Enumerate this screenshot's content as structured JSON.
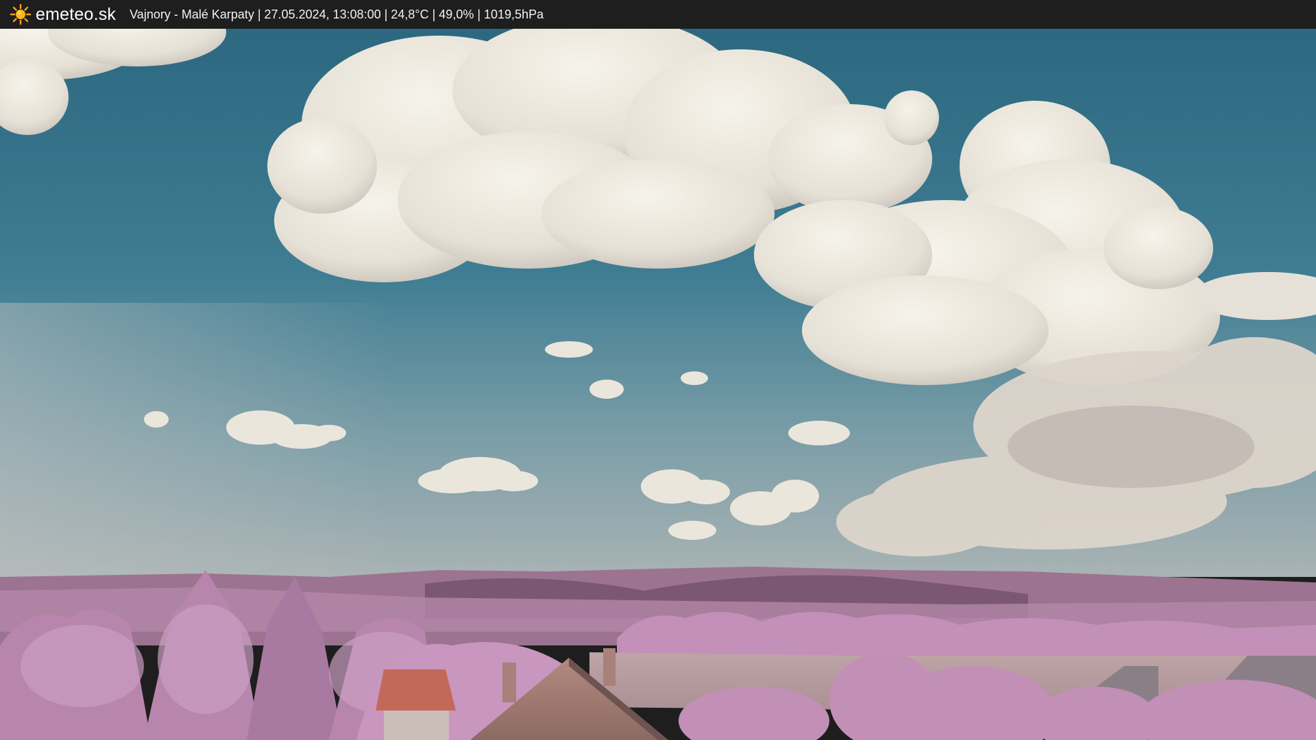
{
  "header": {
    "logo_icon": "sun-icon",
    "site_name": "emeteo.sk",
    "caption": "Vajnory - Malé Karpaty | 27.05.2024, 13:08:00 | 24,8°C | 49,0% | 1019,5hPa"
  },
  "colors": {
    "bar_background": "#1e1e1e",
    "sun_yellow": "#f6a21a",
    "sky_top": "#2f6f86",
    "sky_horizon": "#8fa9b0",
    "hills": "#9a6f8e",
    "foliage": "#c08fb6"
  }
}
